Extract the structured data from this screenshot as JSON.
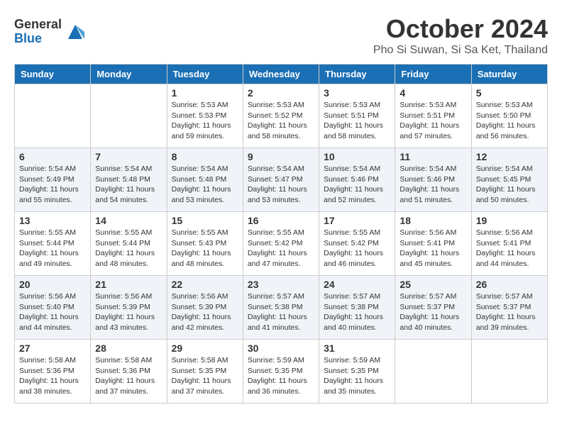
{
  "header": {
    "logo_general": "General",
    "logo_blue": "Blue",
    "month": "October 2024",
    "location": "Pho Si Suwan, Si Sa Ket, Thailand"
  },
  "weekdays": [
    "Sunday",
    "Monday",
    "Tuesday",
    "Wednesday",
    "Thursday",
    "Friday",
    "Saturday"
  ],
  "weeks": [
    [
      {
        "day": "",
        "info": ""
      },
      {
        "day": "",
        "info": ""
      },
      {
        "day": "1",
        "info": "Sunrise: 5:53 AM\nSunset: 5:53 PM\nDaylight: 11 hours and 59 minutes."
      },
      {
        "day": "2",
        "info": "Sunrise: 5:53 AM\nSunset: 5:52 PM\nDaylight: 11 hours and 58 minutes."
      },
      {
        "day": "3",
        "info": "Sunrise: 5:53 AM\nSunset: 5:51 PM\nDaylight: 11 hours and 58 minutes."
      },
      {
        "day": "4",
        "info": "Sunrise: 5:53 AM\nSunset: 5:51 PM\nDaylight: 11 hours and 57 minutes."
      },
      {
        "day": "5",
        "info": "Sunrise: 5:53 AM\nSunset: 5:50 PM\nDaylight: 11 hours and 56 minutes."
      }
    ],
    [
      {
        "day": "6",
        "info": "Sunrise: 5:54 AM\nSunset: 5:49 PM\nDaylight: 11 hours and 55 minutes."
      },
      {
        "day": "7",
        "info": "Sunrise: 5:54 AM\nSunset: 5:48 PM\nDaylight: 11 hours and 54 minutes."
      },
      {
        "day": "8",
        "info": "Sunrise: 5:54 AM\nSunset: 5:48 PM\nDaylight: 11 hours and 53 minutes."
      },
      {
        "day": "9",
        "info": "Sunrise: 5:54 AM\nSunset: 5:47 PM\nDaylight: 11 hours and 53 minutes."
      },
      {
        "day": "10",
        "info": "Sunrise: 5:54 AM\nSunset: 5:46 PM\nDaylight: 11 hours and 52 minutes."
      },
      {
        "day": "11",
        "info": "Sunrise: 5:54 AM\nSunset: 5:46 PM\nDaylight: 11 hours and 51 minutes."
      },
      {
        "day": "12",
        "info": "Sunrise: 5:54 AM\nSunset: 5:45 PM\nDaylight: 11 hours and 50 minutes."
      }
    ],
    [
      {
        "day": "13",
        "info": "Sunrise: 5:55 AM\nSunset: 5:44 PM\nDaylight: 11 hours and 49 minutes."
      },
      {
        "day": "14",
        "info": "Sunrise: 5:55 AM\nSunset: 5:44 PM\nDaylight: 11 hours and 48 minutes."
      },
      {
        "day": "15",
        "info": "Sunrise: 5:55 AM\nSunset: 5:43 PM\nDaylight: 11 hours and 48 minutes."
      },
      {
        "day": "16",
        "info": "Sunrise: 5:55 AM\nSunset: 5:42 PM\nDaylight: 11 hours and 47 minutes."
      },
      {
        "day": "17",
        "info": "Sunrise: 5:55 AM\nSunset: 5:42 PM\nDaylight: 11 hours and 46 minutes."
      },
      {
        "day": "18",
        "info": "Sunrise: 5:56 AM\nSunset: 5:41 PM\nDaylight: 11 hours and 45 minutes."
      },
      {
        "day": "19",
        "info": "Sunrise: 5:56 AM\nSunset: 5:41 PM\nDaylight: 11 hours and 44 minutes."
      }
    ],
    [
      {
        "day": "20",
        "info": "Sunrise: 5:56 AM\nSunset: 5:40 PM\nDaylight: 11 hours and 44 minutes."
      },
      {
        "day": "21",
        "info": "Sunrise: 5:56 AM\nSunset: 5:39 PM\nDaylight: 11 hours and 43 minutes."
      },
      {
        "day": "22",
        "info": "Sunrise: 5:56 AM\nSunset: 5:39 PM\nDaylight: 11 hours and 42 minutes."
      },
      {
        "day": "23",
        "info": "Sunrise: 5:57 AM\nSunset: 5:38 PM\nDaylight: 11 hours and 41 minutes."
      },
      {
        "day": "24",
        "info": "Sunrise: 5:57 AM\nSunset: 5:38 PM\nDaylight: 11 hours and 40 minutes."
      },
      {
        "day": "25",
        "info": "Sunrise: 5:57 AM\nSunset: 5:37 PM\nDaylight: 11 hours and 40 minutes."
      },
      {
        "day": "26",
        "info": "Sunrise: 5:57 AM\nSunset: 5:37 PM\nDaylight: 11 hours and 39 minutes."
      }
    ],
    [
      {
        "day": "27",
        "info": "Sunrise: 5:58 AM\nSunset: 5:36 PM\nDaylight: 11 hours and 38 minutes."
      },
      {
        "day": "28",
        "info": "Sunrise: 5:58 AM\nSunset: 5:36 PM\nDaylight: 11 hours and 37 minutes."
      },
      {
        "day": "29",
        "info": "Sunrise: 5:58 AM\nSunset: 5:35 PM\nDaylight: 11 hours and 37 minutes."
      },
      {
        "day": "30",
        "info": "Sunrise: 5:59 AM\nSunset: 5:35 PM\nDaylight: 11 hours and 36 minutes."
      },
      {
        "day": "31",
        "info": "Sunrise: 5:59 AM\nSunset: 5:35 PM\nDaylight: 11 hours and 35 minutes."
      },
      {
        "day": "",
        "info": ""
      },
      {
        "day": "",
        "info": ""
      }
    ]
  ]
}
